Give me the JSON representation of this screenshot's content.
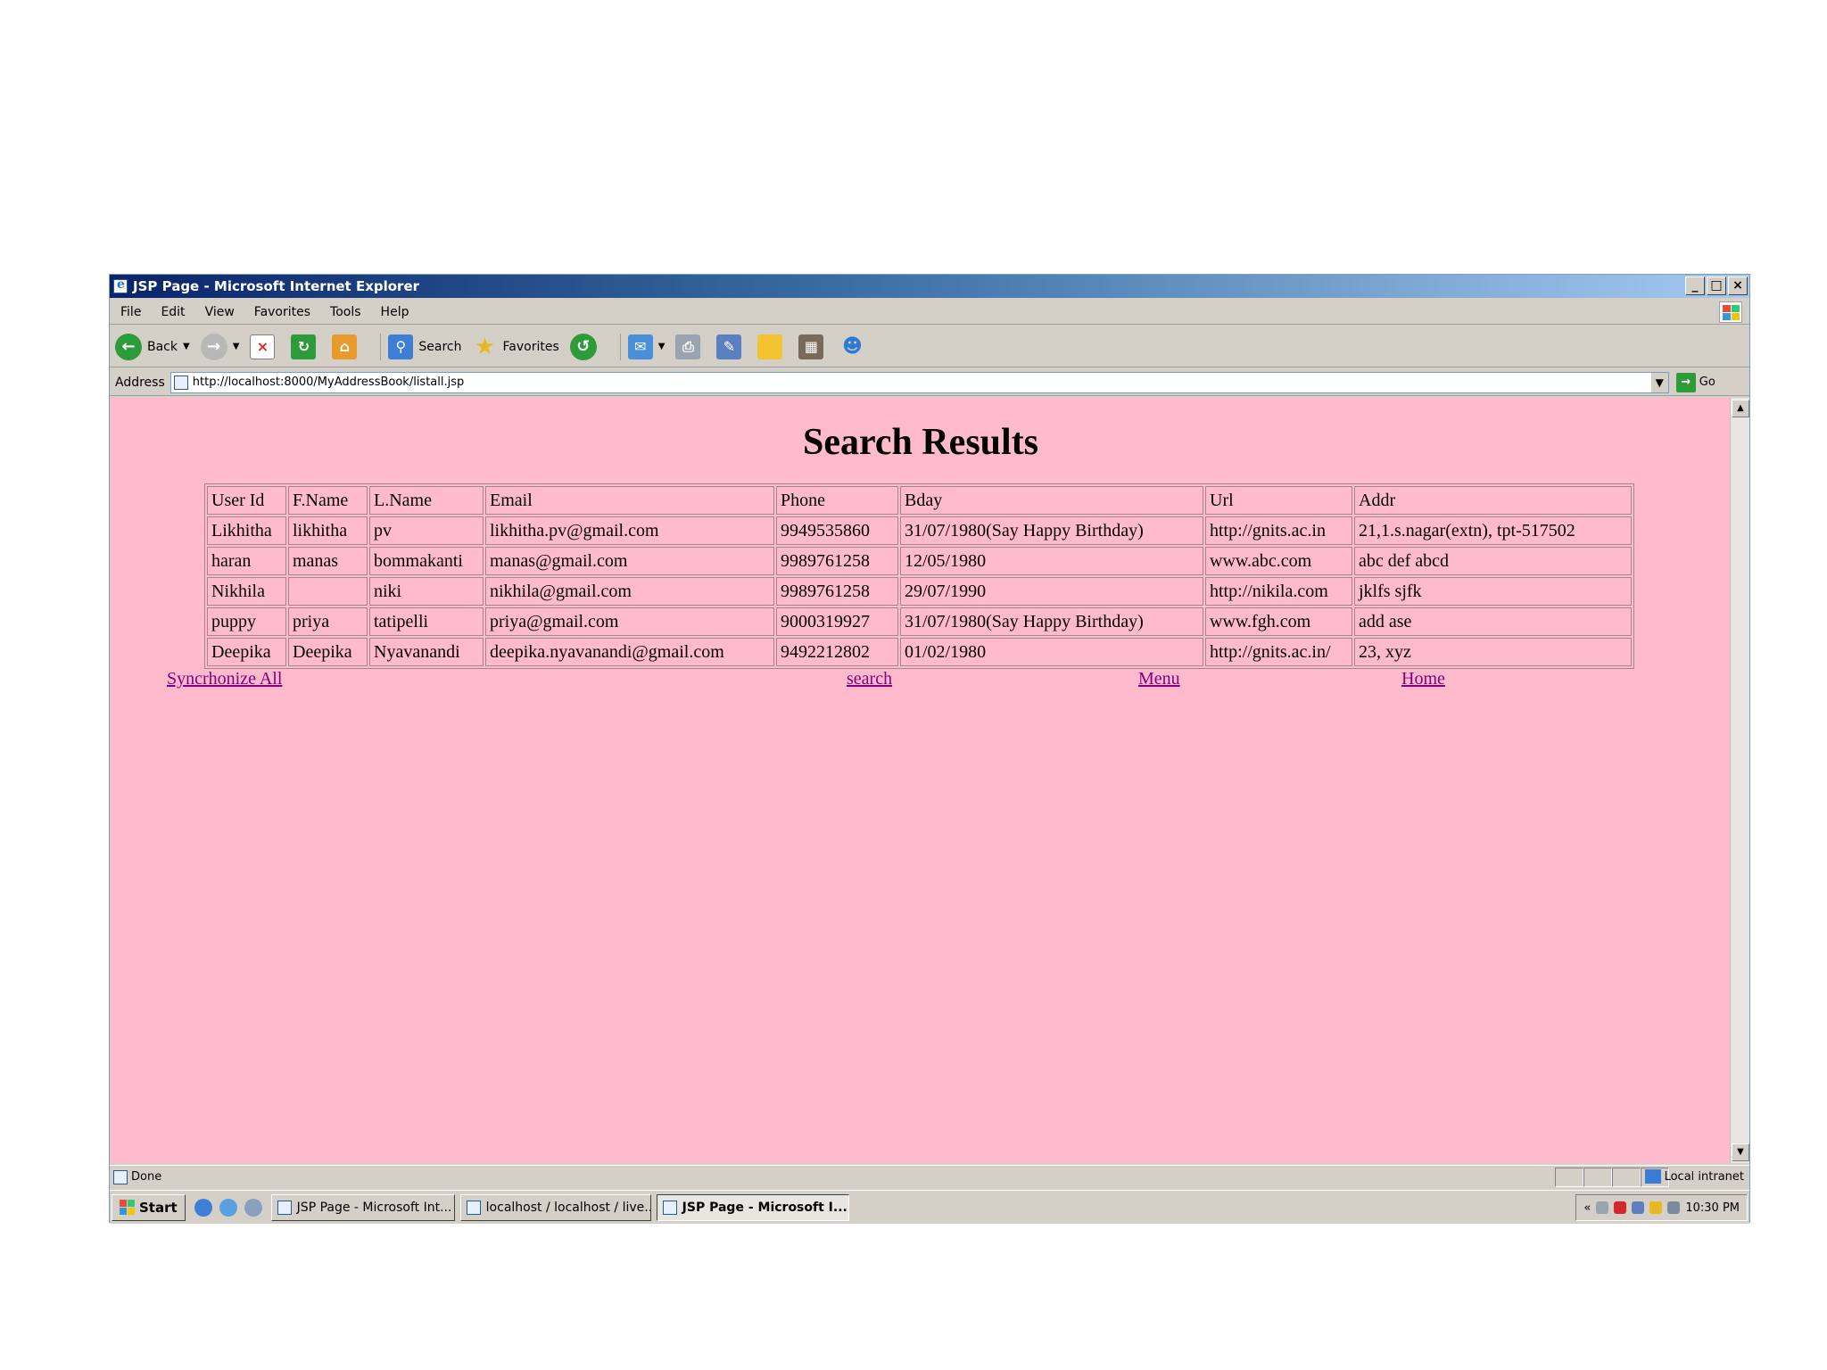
{
  "window": {
    "title": "JSP Page - Microsoft Internet Explorer",
    "minimize": "_",
    "maximize": "□",
    "close": "×"
  },
  "menu": [
    "File",
    "Edit",
    "View",
    "Favorites",
    "Tools",
    "Help"
  ],
  "toolbar": {
    "back_label": "Back",
    "search_label": "Search",
    "favorites_label": "Favorites"
  },
  "address": {
    "label": "Address",
    "url": "http://localhost:8000/MyAddressBook/listall.jsp",
    "go_label": "Go"
  },
  "page": {
    "title": "Search Results",
    "columns": [
      "User Id",
      "F.Name",
      "L.Name",
      "Email",
      "Phone",
      "Bday",
      "Url",
      "Addr"
    ],
    "rows": [
      [
        "Likhitha",
        "likhitha",
        "pv",
        "likhitha.pv@gmail.com",
        "9949535860",
        "31/07/1980(Say Happy Birthday)",
        "http://gnits.ac.in",
        "21,1.s.nagar(extn), tpt-517502"
      ],
      [
        "haran",
        "manas",
        "bommakanti",
        "manas@gmail.com",
        "9989761258",
        "12/05/1980",
        "www.abc.com",
        "abc def abcd"
      ],
      [
        "Nikhila",
        "",
        "niki",
        "nikhila@gmail.com",
        "9989761258",
        "29/07/1990",
        "http://nikila.com",
        "jklfs sjfk"
      ],
      [
        "puppy",
        "priya",
        "tatipelli",
        "priya@gmail.com",
        "9000319927",
        "31/07/1980(Say Happy Birthday)",
        "www.fgh.com",
        "add ase"
      ],
      [
        "Deepika",
        "Deepika",
        "Nyavanandi",
        "deepika.nyavanandi@gmail.com",
        "9492212802",
        "01/02/1980",
        "http://gnits.ac.in/",
        "23, xyz"
      ]
    ],
    "links": {
      "synchronize": "Syncrhonize All",
      "search": "search",
      "menu": "Menu",
      "home": "Home"
    }
  },
  "status": {
    "text": "Done",
    "zone": "Local intranet"
  },
  "taskbar": {
    "start_label": "Start",
    "tasks": [
      "JSP Page - Microsoft Int...",
      "localhost / localhost / live...",
      "JSP Page - Microsoft I..."
    ],
    "tray_expand": "«",
    "clock": "10:30 PM"
  },
  "colors": {
    "page_background": "#ffbbcc",
    "link_visited": "#800080",
    "chrome": "#d4d0c8"
  }
}
